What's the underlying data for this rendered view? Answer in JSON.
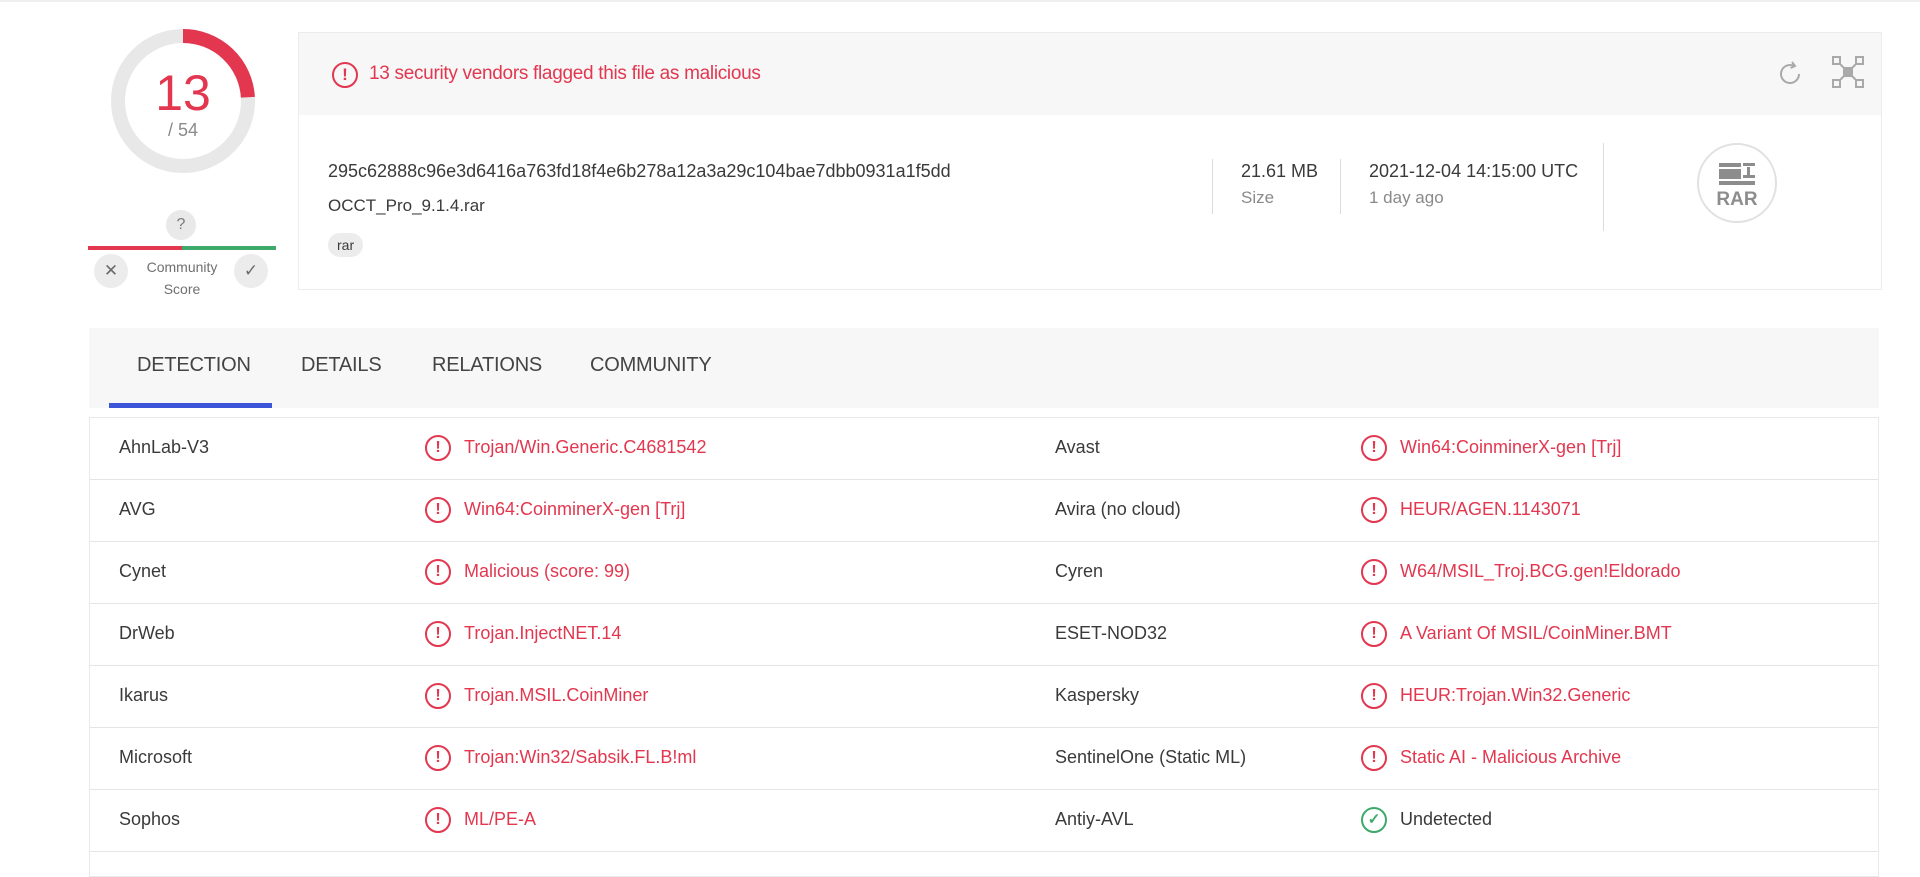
{
  "score": {
    "detected": "13",
    "total": "/ 54",
    "fraction": 0.2407
  },
  "community": {
    "question": "?",
    "label_line1": "Community",
    "label_line2": "Score",
    "down_glyph": "✕",
    "up_glyph": "✓"
  },
  "alert": {
    "text": "13 security vendors flagged this file as malicious",
    "icon": "!"
  },
  "file": {
    "hash": "295c62888c96e3d6416a763fd18f4e6b278a12a3a29c104bae7dbb0931a1f5dd",
    "name": "OCCT_Pro_9.1.4.rar",
    "tag": "rar",
    "size_value": "21.61 MB",
    "size_label": "Size",
    "date_value": "2021-12-04 14:15:00 UTC",
    "date_label": "1 day ago",
    "type_icon_text": "RAR"
  },
  "tabs": [
    {
      "label": "DETECTION",
      "active": true
    },
    {
      "label": "DETAILS",
      "active": false
    },
    {
      "label": "RELATIONS",
      "active": false
    },
    {
      "label": "COMMUNITY",
      "active": false
    }
  ],
  "detections": [
    {
      "left": {
        "vendor": "AhnLab-V3",
        "result": "Trojan/Win.Generic.C4681542",
        "status": "malicious"
      },
      "right": {
        "vendor": "Avast",
        "result": "Win64:CoinminerX-gen [Trj]",
        "status": "malicious"
      }
    },
    {
      "left": {
        "vendor": "AVG",
        "result": "Win64:CoinminerX-gen [Trj]",
        "status": "malicious"
      },
      "right": {
        "vendor": "Avira (no cloud)",
        "result": "HEUR/AGEN.1143071",
        "status": "malicious"
      }
    },
    {
      "left": {
        "vendor": "Cynet",
        "result": "Malicious (score: 99)",
        "status": "malicious"
      },
      "right": {
        "vendor": "Cyren",
        "result": "W64/MSIL_Troj.BCG.gen!Eldorado",
        "status": "malicious"
      }
    },
    {
      "left": {
        "vendor": "DrWeb",
        "result": "Trojan.InjectNET.14",
        "status": "malicious"
      },
      "right": {
        "vendor": "ESET-NOD32",
        "result": "A Variant Of MSIL/CoinMiner.BMT",
        "status": "malicious"
      }
    },
    {
      "left": {
        "vendor": "Ikarus",
        "result": "Trojan.MSIL.CoinMiner",
        "status": "malicious"
      },
      "right": {
        "vendor": "Kaspersky",
        "result": "HEUR:Trojan.Win32.Generic",
        "status": "malicious"
      }
    },
    {
      "left": {
        "vendor": "Microsoft",
        "result": "Trojan:Win32/Sabsik.FL.B!ml",
        "status": "malicious"
      },
      "right": {
        "vendor": "SentinelOne (Static ML)",
        "result": "Static AI - Malicious Archive",
        "status": "malicious"
      }
    },
    {
      "left": {
        "vendor": "Sophos",
        "result": "ML/PE-A",
        "status": "malicious"
      },
      "right": {
        "vendor": "Antiy-AVL",
        "result": "Undetected",
        "status": "undetected"
      }
    }
  ],
  "icons": {
    "malicious": "!",
    "undetected": "✓",
    "reload": "reload-icon",
    "graph": "graph-icon"
  },
  "colors": {
    "malicious": "#e2374f",
    "clean": "#3ea96a",
    "accent": "#3b57d8"
  }
}
